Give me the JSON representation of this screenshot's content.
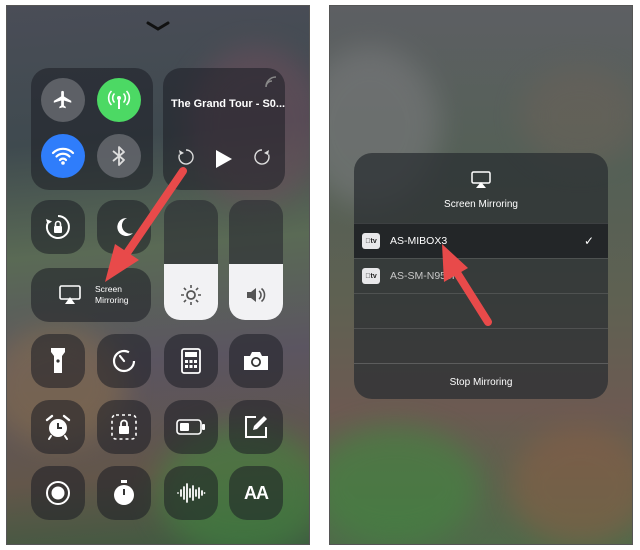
{
  "left_screen": {
    "connectivity": {
      "airplane": "airplane-icon",
      "cellular": "cellular-icon",
      "wifi": "wifi-icon",
      "bluetooth": "bluetooth-icon"
    },
    "media": {
      "title": "The Grand Tour  - S0..."
    },
    "brightness_level": 0.47,
    "volume_level": 0.47,
    "screen_mirroring_label": "Screen\nMirroring",
    "tiles": [
      "flashlight-icon",
      "timer-icon",
      "calculator-icon",
      "camera-icon",
      "alarm-icon",
      "guided-access-icon",
      "low-power-icon",
      "notes-icon",
      "screen-record-icon",
      "stopwatch-icon",
      "voice-memos-icon",
      "text-size-icon"
    ],
    "text_size_label": "AA"
  },
  "right_screen": {
    "panel_title": "Screen Mirroring",
    "devices": [
      {
        "badge": "tv",
        "name": "AS-MIBOX3",
        "selected": true
      },
      {
        "badge": "tv",
        "name": "AS-SM-N950F",
        "selected": false
      }
    ],
    "stop_label": "Stop Mirroring"
  },
  "colors": {
    "cellular_active": "#4cd964",
    "wifi_active": "#2f7dfb",
    "arrow": "#e84a4a"
  }
}
